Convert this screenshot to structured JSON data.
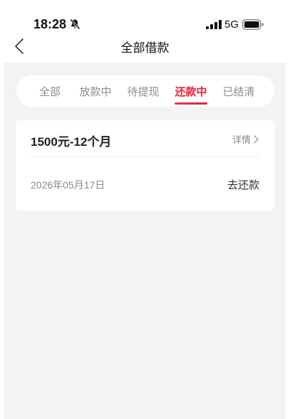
{
  "status_bar": {
    "time": "18:28",
    "network": "5G"
  },
  "nav": {
    "title": "全部借款"
  },
  "tabs": [
    {
      "label": "全部",
      "active": false
    },
    {
      "label": "放款中",
      "active": false
    },
    {
      "label": "待提现",
      "active": false
    },
    {
      "label": "还款中",
      "active": true
    },
    {
      "label": "已结清",
      "active": false
    }
  ],
  "loan": {
    "title": "1500元-12个月",
    "detail_label": "详情",
    "due_date": "2026年05月17日",
    "action_label": "去还款"
  },
  "colors": {
    "accent": "#e8213a",
    "background": "#f3f3f5",
    "card": "#ffffff"
  },
  "icons": {
    "back": "chevron-left-icon",
    "detail": "chevron-right-icon",
    "mute": "bell-slash-icon",
    "signal": "signal-icon",
    "battery": "battery-icon"
  }
}
